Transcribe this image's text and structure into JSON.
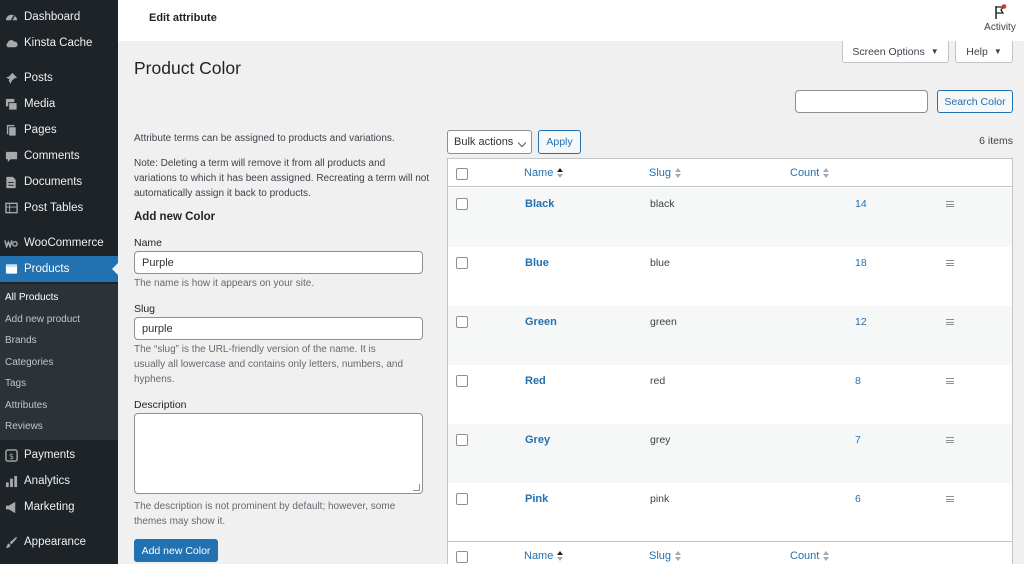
{
  "sidebar": {
    "items": [
      {
        "label": "Dashboard",
        "icon": "dashboard-icon"
      },
      {
        "label": "Kinsta Cache",
        "icon": "cloud-icon"
      },
      {
        "label": "Posts",
        "icon": "pin-icon"
      },
      {
        "label": "Media",
        "icon": "media-icon"
      },
      {
        "label": "Pages",
        "icon": "pages-icon"
      },
      {
        "label": "Comments",
        "icon": "comments-icon"
      },
      {
        "label": "Documents",
        "icon": "documents-icon"
      },
      {
        "label": "Post Tables",
        "icon": "table-icon"
      },
      {
        "label": "WooCommerce",
        "icon": "woo-icon"
      },
      {
        "label": "Products",
        "icon": "products-icon"
      },
      {
        "label": "Payments",
        "icon": "payments-icon"
      },
      {
        "label": "Analytics",
        "icon": "analytics-icon"
      },
      {
        "label": "Marketing",
        "icon": "megaphone-icon"
      },
      {
        "label": "Appearance",
        "icon": "brush-icon"
      }
    ],
    "submenu": [
      "All Products",
      "Add new product",
      "Brands",
      "Categories",
      "Tags",
      "Attributes",
      "Reviews"
    ]
  },
  "header": {
    "title": "Edit attribute",
    "activity_label": "Activity"
  },
  "screen_options_label": "Screen Options",
  "help_label": "Help",
  "page_title": "Product Color",
  "search": {
    "value": "",
    "button_label": "Search Color"
  },
  "form": {
    "intro": "Attribute terms can be assigned to products and variations.",
    "note": "Note: Deleting a term will remove it from all products and variations to which it has been assigned. Recreating a term will not automatically assign it back to products.",
    "heading": "Add new Color",
    "name_label": "Name",
    "name_value": "Purple",
    "name_desc": "The name is how it appears on your site.",
    "slug_label": "Slug",
    "slug_value": "purple",
    "slug_desc": "The “slug” is the URL-friendly version of the name. It is usually all lowercase and contains only letters, numbers, and hyphens.",
    "description_label": "Description",
    "description_desc": "The description is not prominent by default; however, some themes may show it.",
    "submit_label": "Add new Color"
  },
  "table": {
    "bulk_label": "Bulk actions",
    "apply_label": "Apply",
    "items_count": "6 items",
    "columns": {
      "name": "Name",
      "slug": "Slug",
      "count": "Count"
    },
    "rows": [
      {
        "name": "Black",
        "slug": "black",
        "count": "14"
      },
      {
        "name": "Blue",
        "slug": "blue",
        "count": "18"
      },
      {
        "name": "Green",
        "slug": "green",
        "count": "12"
      },
      {
        "name": "Red",
        "slug": "red",
        "count": "8"
      },
      {
        "name": "Grey",
        "slug": "grey",
        "count": "7"
      },
      {
        "name": "Pink",
        "slug": "pink",
        "count": "6"
      }
    ]
  },
  "colors": {
    "sidebar_bg": "#1d2327",
    "accent": "#2271b1",
    "page_bg": "#f0f0f1",
    "notification": "#d63638"
  }
}
